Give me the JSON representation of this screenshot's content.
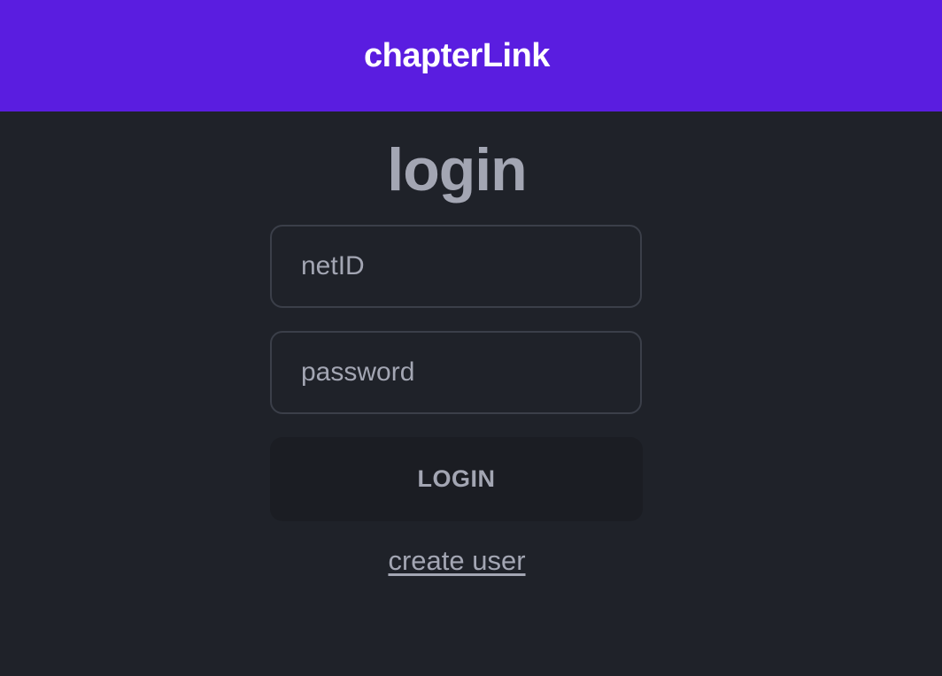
{
  "header": {
    "brand": "chapterLink",
    "background": "#5a1de0"
  },
  "login": {
    "title": "login",
    "netid_placeholder": "netID",
    "password_placeholder": "password",
    "button_label": "LOGIN",
    "create_user_label": "create user"
  },
  "colors": {
    "page_background": "#1f2229",
    "text_muted": "#a3a6b3",
    "input_border": "#3b3f49",
    "button_background": "#1b1d23"
  }
}
